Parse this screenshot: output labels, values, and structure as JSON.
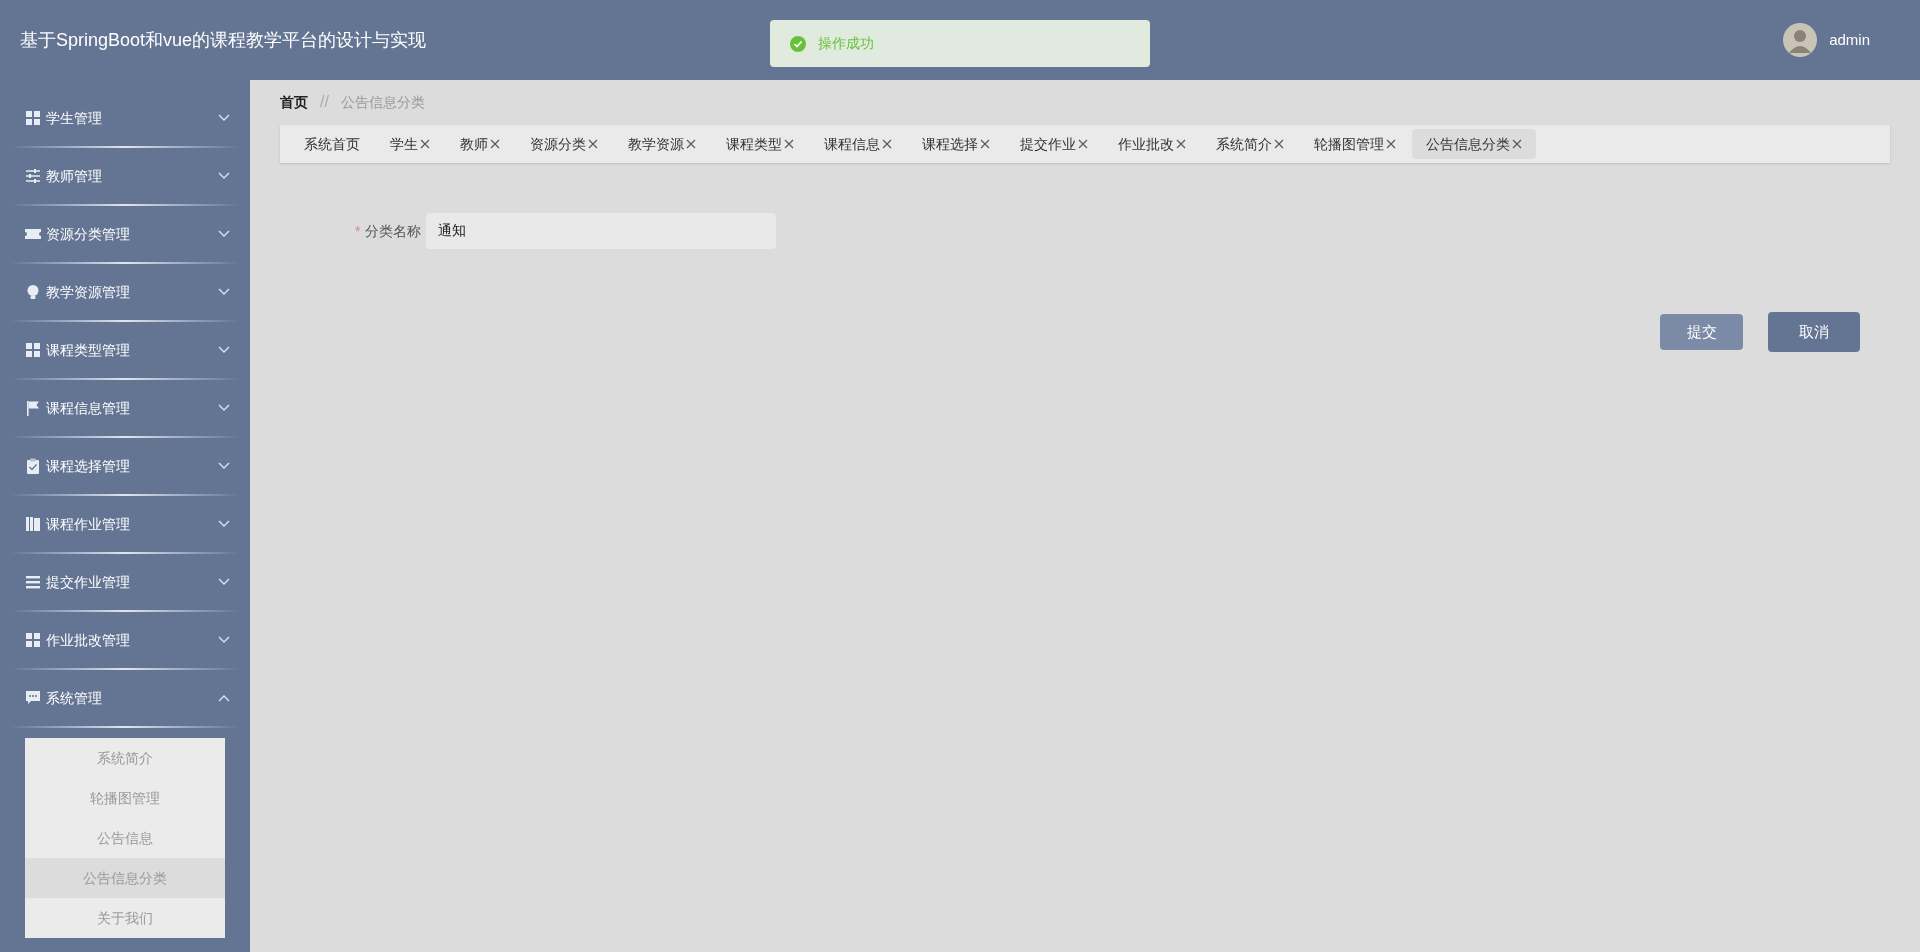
{
  "header": {
    "title": "基于SpringBoot和vue的课程教学平台的设计与实现",
    "user": "admin"
  },
  "toast": {
    "message": "操作成功"
  },
  "sidebar": {
    "items": [
      {
        "label": "学生管理",
        "kind": "grid",
        "expanded": false
      },
      {
        "label": "教师管理",
        "kind": "sliders",
        "expanded": false
      },
      {
        "label": "资源分类管理",
        "kind": "ticket",
        "expanded": false
      },
      {
        "label": "教学资源管理",
        "kind": "bulb",
        "expanded": false
      },
      {
        "label": "课程类型管理",
        "kind": "grid",
        "expanded": false
      },
      {
        "label": "课程信息管理",
        "kind": "flag",
        "expanded": false
      },
      {
        "label": "课程选择管理",
        "kind": "clipboard",
        "expanded": false
      },
      {
        "label": "课程作业管理",
        "kind": "book",
        "expanded": false
      },
      {
        "label": "提交作业管理",
        "kind": "list",
        "expanded": false
      },
      {
        "label": "作业批改管理",
        "kind": "grid",
        "expanded": false
      },
      {
        "label": "系统管理",
        "kind": "chat",
        "expanded": true,
        "children": [
          {
            "label": "系统简介",
            "selected": false
          },
          {
            "label": "轮播图管理",
            "selected": false
          },
          {
            "label": "公告信息",
            "selected": false
          },
          {
            "label": "公告信息分类",
            "selected": true
          },
          {
            "label": "关于我们",
            "selected": false
          }
        ]
      }
    ]
  },
  "breadcrumb": [
    {
      "label": "首页"
    },
    {
      "label": "公告信息分类",
      "separator": "//"
    }
  ],
  "tabs": [
    {
      "label": "系统首页",
      "closable": false,
      "selected": false
    },
    {
      "label": "学生",
      "closable": true,
      "selected": false
    },
    {
      "label": "教师",
      "closable": true,
      "selected": false
    },
    {
      "label": "资源分类",
      "closable": true,
      "selected": false
    },
    {
      "label": "教学资源",
      "closable": true,
      "selected": false
    },
    {
      "label": "课程类型",
      "closable": true,
      "selected": false
    },
    {
      "label": "课程信息",
      "closable": true,
      "selected": false
    },
    {
      "label": "课程选择",
      "closable": true,
      "selected": false
    },
    {
      "label": "提交作业",
      "closable": true,
      "selected": false
    },
    {
      "label": "作业批改",
      "closable": true,
      "selected": false
    },
    {
      "label": "系统简介",
      "closable": true,
      "selected": false
    },
    {
      "label": "轮播图管理",
      "closable": true,
      "selected": false
    },
    {
      "label": "公告信息分类",
      "closable": true,
      "selected": true
    }
  ],
  "form": {
    "field": {
      "label": "分类名称",
      "required_mark": "*",
      "value": "通知"
    }
  },
  "buttons": [
    {
      "label": "提交",
      "kind": "submit",
      "disabled": true
    },
    {
      "label": "取消",
      "kind": "cancel",
      "disabled": false
    }
  ]
}
